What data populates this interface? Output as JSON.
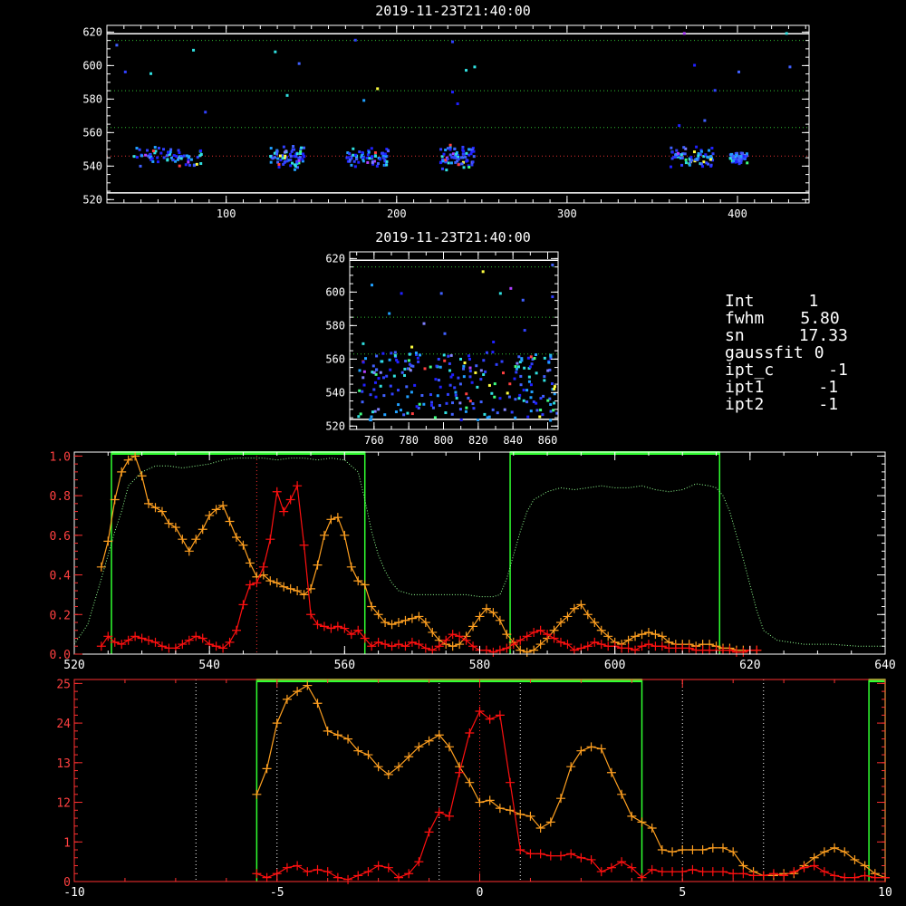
{
  "info": [
    {
      "label": "Int",
      "value": "1"
    },
    {
      "label": "fwhm",
      "value": "5.80"
    },
    {
      "label": "sn",
      "value": "17.33"
    },
    {
      "label": "gaussfit",
      "value": "0"
    },
    {
      "label": "ipt_c",
      "value": "-1"
    },
    {
      "label": "ipt1",
      "value": "-1"
    },
    {
      "label": "ipt2",
      "value": "-1"
    }
  ],
  "chart_data": [
    {
      "type": "scatter",
      "title": "2019-11-23T21:40:00",
      "xlim": [
        30,
        442
      ],
      "ylim": [
        518,
        624
      ],
      "xticks": [
        100,
        200,
        300,
        400
      ],
      "yticks": [
        520,
        540,
        560,
        580,
        600,
        620
      ],
      "hlines_white": [
        524,
        619
      ],
      "hlines_green": [
        563,
        585,
        615
      ],
      "hlines_red": [
        546
      ],
      "clusters": [
        [
          45,
          85,
          546,
          7
        ],
        [
          125,
          145,
          546,
          8
        ],
        [
          170,
          195,
          546,
          7
        ],
        [
          225,
          245,
          546,
          8
        ],
        [
          360,
          385,
          546,
          7
        ],
        [
          395,
          405,
          546,
          4
        ]
      ],
      "scatter_points": [
        [
          35,
          613
        ],
        [
          40,
          597
        ],
        [
          55,
          596
        ],
        [
          80,
          610
        ],
        [
          128,
          609
        ],
        [
          142,
          602
        ],
        [
          175,
          616
        ],
        [
          188,
          587
        ],
        [
          232,
          615
        ],
        [
          240,
          598
        ],
        [
          245,
          600
        ],
        [
          368,
          620
        ],
        [
          374,
          601
        ],
        [
          386,
          586
        ],
        [
          400,
          597
        ],
        [
          428,
          620
        ],
        [
          232,
          585
        ],
        [
          235,
          578
        ],
        [
          135,
          583
        ],
        [
          180,
          580
        ],
        [
          365,
          565
        ],
        [
          380,
          568
        ],
        [
          87,
          573
        ],
        [
          430,
          600
        ]
      ]
    },
    {
      "type": "scatter",
      "title": "2019-11-23T21:40:00",
      "xlim": [
        746,
        866
      ],
      "ylim": [
        518,
        624
      ],
      "xticks": [
        760,
        780,
        800,
        820,
        840,
        860
      ],
      "yticks": [
        520,
        540,
        560,
        580,
        600,
        620
      ],
      "hlines_white": [
        524,
        619
      ],
      "hlines_green": [
        563,
        585,
        615
      ],
      "density_region": [
        750,
        866,
        524,
        565
      ],
      "scatter_points": [
        [
          758,
          605
        ],
        [
          775,
          600
        ],
        [
          798,
          600
        ],
        [
          822,
          613
        ],
        [
          832,
          600
        ],
        [
          838,
          603
        ],
        [
          862,
          617
        ],
        [
          768,
          588
        ],
        [
          788,
          582
        ],
        [
          800,
          576
        ],
        [
          828,
          571
        ],
        [
          846,
          578
        ],
        [
          753,
          570
        ],
        [
          781,
          568
        ],
        [
          845,
          596
        ],
        [
          862,
          598
        ]
      ]
    },
    {
      "type": "line",
      "xlim": [
        520,
        640
      ],
      "x_ticks": [
        520,
        540,
        560,
        580,
        600,
        620,
        640
      ],
      "y_tick_labels": [
        "0.0",
        "0.2",
        "0.4",
        "0.6",
        "0.8",
        "1.0"
      ],
      "y_tick_values": [
        0.0,
        0.2,
        0.4,
        0.6,
        0.8,
        1.0
      ],
      "ylim": [
        0,
        1.02
      ],
      "green_boxes": [
        [
          525.5,
          563.0
        ],
        [
          584.5,
          615.5
        ]
      ],
      "red_vline": 547,
      "series": [
        {
          "color": "#ffa020",
          "x": [
            524,
            525,
            526,
            527,
            528,
            529,
            530,
            531,
            532,
            533,
            534,
            535,
            536,
            537,
            538,
            539,
            540,
            541,
            542,
            543,
            544,
            545,
            546,
            547,
            548,
            549,
            550,
            551,
            552,
            553,
            554,
            555,
            556,
            557,
            558,
            559,
            560,
            561,
            562,
            563,
            564,
            565,
            566,
            567,
            568,
            569,
            570,
            571,
            572,
            573,
            574,
            575,
            576,
            577,
            578,
            579,
            580,
            581,
            582,
            583,
            584,
            585,
            586,
            587,
            588,
            589,
            590,
            591,
            592,
            593,
            594,
            595,
            596,
            597,
            598,
            599,
            600,
            601,
            602,
            603,
            604,
            605,
            606,
            607,
            608,
            609,
            610,
            611,
            612,
            613,
            614,
            615,
            616,
            617,
            618,
            619,
            620,
            621
          ],
          "y": [
            0.44,
            0.57,
            0.78,
            0.92,
            0.98,
            1.0,
            0.9,
            0.76,
            0.74,
            0.72,
            0.66,
            0.64,
            0.58,
            0.52,
            0.58,
            0.63,
            0.7,
            0.73,
            0.75,
            0.67,
            0.59,
            0.55,
            0.46,
            0.39,
            0.4,
            0.37,
            0.36,
            0.34,
            0.33,
            0.32,
            0.3,
            0.33,
            0.45,
            0.6,
            0.68,
            0.69,
            0.6,
            0.44,
            0.37,
            0.35,
            0.24,
            0.2,
            0.16,
            0.15,
            0.16,
            0.17,
            0.18,
            0.19,
            0.16,
            0.11,
            0.07,
            0.05,
            0.04,
            0.05,
            0.09,
            0.14,
            0.19,
            0.23,
            0.21,
            0.17,
            0.1,
            0.06,
            0.02,
            0.01,
            0.02,
            0.05,
            0.08,
            0.12,
            0.16,
            0.19,
            0.23,
            0.25,
            0.2,
            0.16,
            0.12,
            0.09,
            0.06,
            0.05,
            0.07,
            0.09,
            0.1,
            0.11,
            0.1,
            0.09,
            0.06,
            0.05,
            0.05,
            0.05,
            0.04,
            0.05,
            0.05,
            0.04,
            0.03,
            0.03,
            0.02,
            0.02,
            0.02,
            0.02
          ]
        },
        {
          "color": "#ff1010",
          "x": [
            524,
            525,
            526,
            527,
            528,
            529,
            530,
            531,
            532,
            533,
            534,
            535,
            536,
            537,
            538,
            539,
            540,
            541,
            542,
            543,
            544,
            545,
            546,
            547,
            548,
            549,
            550,
            551,
            552,
            553,
            554,
            555,
            556,
            557,
            558,
            559,
            560,
            561,
            562,
            563,
            564,
            565,
            566,
            567,
            568,
            569,
            570,
            571,
            572,
            573,
            574,
            575,
            576,
            577,
            578,
            579,
            580,
            581,
            582,
            583,
            584,
            585,
            586,
            587,
            588,
            589,
            590,
            591,
            592,
            593,
            594,
            595,
            596,
            597,
            598,
            599,
            600,
            601,
            602,
            603,
            604,
            605,
            606,
            607,
            608,
            609,
            610,
            611,
            612,
            613,
            614,
            615,
            616,
            617,
            618,
            619,
            620,
            621
          ],
          "y": [
            0.04,
            0.09,
            0.06,
            0.05,
            0.07,
            0.09,
            0.08,
            0.07,
            0.06,
            0.04,
            0.03,
            0.03,
            0.05,
            0.07,
            0.09,
            0.08,
            0.05,
            0.04,
            0.03,
            0.06,
            0.12,
            0.25,
            0.35,
            0.36,
            0.44,
            0.58,
            0.82,
            0.72,
            0.78,
            0.85,
            0.55,
            0.2,
            0.15,
            0.14,
            0.13,
            0.14,
            0.13,
            0.1,
            0.12,
            0.08,
            0.04,
            0.06,
            0.05,
            0.04,
            0.05,
            0.04,
            0.06,
            0.05,
            0.03,
            0.02,
            0.04,
            0.07,
            0.1,
            0.09,
            0.07,
            0.04,
            0.02,
            0.02,
            0.01,
            0.02,
            0.03,
            0.05,
            0.07,
            0.09,
            0.11,
            0.12,
            0.1,
            0.08,
            0.06,
            0.05,
            0.02,
            0.03,
            0.04,
            0.06,
            0.05,
            0.04,
            0.04,
            0.03,
            0.03,
            0.02,
            0.04,
            0.05,
            0.04,
            0.04,
            0.03,
            0.03,
            0.03,
            0.03,
            0.02,
            0.02,
            0.02,
            0.02,
            0.02,
            0.02,
            0.01,
            0.01,
            0.02,
            0.02
          ]
        },
        {
          "color": "#90ff90",
          "style": "dotted",
          "x": [
            520,
            522,
            524,
            525,
            526,
            527,
            528,
            530,
            532,
            534,
            536,
            538,
            540,
            542,
            544,
            546,
            548,
            550,
            552,
            554,
            556,
            558,
            560,
            562,
            563,
            564,
            565,
            566,
            567,
            568,
            569,
            570,
            572,
            574,
            576,
            578,
            580,
            582,
            583,
            584,
            585,
            586,
            587,
            588,
            590,
            592,
            594,
            596,
            598,
            600,
            602,
            604,
            606,
            608,
            610,
            612,
            614,
            615,
            616,
            617,
            618,
            619,
            620,
            621,
            622,
            624,
            628,
            632,
            636,
            640
          ],
          "y": [
            0.05,
            0.15,
            0.38,
            0.5,
            0.62,
            0.72,
            0.85,
            0.92,
            0.95,
            0.95,
            0.94,
            0.95,
            0.96,
            0.98,
            0.99,
            0.99,
            0.99,
            0.98,
            0.99,
            0.99,
            0.98,
            0.99,
            0.98,
            0.92,
            0.78,
            0.62,
            0.5,
            0.42,
            0.36,
            0.32,
            0.31,
            0.3,
            0.3,
            0.3,
            0.3,
            0.3,
            0.29,
            0.29,
            0.3,
            0.38,
            0.5,
            0.62,
            0.72,
            0.78,
            0.82,
            0.84,
            0.83,
            0.84,
            0.85,
            0.84,
            0.84,
            0.85,
            0.83,
            0.82,
            0.83,
            0.86,
            0.85,
            0.84,
            0.8,
            0.72,
            0.6,
            0.48,
            0.35,
            0.22,
            0.12,
            0.07,
            0.05,
            0.05,
            0.04,
            0.04
          ]
        }
      ]
    },
    {
      "type": "line",
      "xlim": [
        -10,
        10
      ],
      "x_ticks": [
        -10,
        -5,
        0,
        5,
        10
      ],
      "y_tick_labels": [
        "0",
        "1",
        "12",
        "13",
        "24",
        "25"
      ],
      "y_tick_values": [
        0,
        0.2,
        0.4,
        0.6,
        0.8,
        1.0
      ],
      "ylim": [
        0,
        1.02
      ],
      "green_boxes": [
        [
          -5.5,
          4.0
        ],
        [
          9.6,
          10.0
        ]
      ],
      "red_vline": 0,
      "white_vlines": [
        -7,
        -5,
        -1,
        1,
        5,
        7
      ],
      "series": [
        {
          "color": "#ffa020",
          "x": [
            -5.5,
            -5.25,
            -5.0,
            -4.75,
            -4.5,
            -4.25,
            -4.0,
            -3.75,
            -3.5,
            -3.25,
            -3.0,
            -2.75,
            -2.5,
            -2.25,
            -2.0,
            -1.75,
            -1.5,
            -1.25,
            -1.0,
            -0.75,
            -0.5,
            -0.25,
            0.0,
            0.25,
            0.5,
            0.75,
            1.0,
            1.25,
            1.5,
            1.75,
            2.0,
            2.25,
            2.5,
            2.75,
            3.0,
            3.25,
            3.5,
            3.75,
            4.0,
            4.25,
            4.5,
            4.75,
            5.0,
            5.25,
            5.5,
            5.75,
            6.0,
            6.25,
            6.5,
            6.75,
            7.0,
            7.25,
            7.5,
            7.75,
            8.0,
            8.25,
            8.5,
            8.75,
            9.0,
            9.25,
            9.5,
            9.75,
            10.0
          ],
          "y": [
            0.44,
            0.57,
            0.8,
            0.92,
            0.96,
            0.99,
            0.9,
            0.76,
            0.74,
            0.72,
            0.66,
            0.64,
            0.58,
            0.54,
            0.58,
            0.63,
            0.68,
            0.71,
            0.74,
            0.68,
            0.58,
            0.5,
            0.4,
            0.41,
            0.37,
            0.36,
            0.34,
            0.33,
            0.27,
            0.3,
            0.42,
            0.58,
            0.66,
            0.68,
            0.67,
            0.55,
            0.44,
            0.33,
            0.3,
            0.27,
            0.16,
            0.15,
            0.16,
            0.16,
            0.16,
            0.17,
            0.17,
            0.15,
            0.08,
            0.05,
            0.03,
            0.03,
            0.04,
            0.04,
            0.08,
            0.12,
            0.15,
            0.17,
            0.15,
            0.11,
            0.08,
            0.04,
            0.02
          ]
        },
        {
          "color": "#ff1010",
          "x": [
            -5.5,
            -5.25,
            -5.0,
            -4.75,
            -4.5,
            -4.25,
            -4.0,
            -3.75,
            -3.5,
            -3.25,
            -3.0,
            -2.75,
            -2.5,
            -2.25,
            -2.0,
            -1.75,
            -1.5,
            -1.25,
            -1.0,
            -0.75,
            -0.5,
            -0.25,
            0.0,
            0.25,
            0.5,
            0.75,
            1.0,
            1.25,
            1.5,
            1.75,
            2.0,
            2.25,
            2.5,
            2.75,
            3.0,
            3.25,
            3.5,
            3.75,
            4.0,
            4.25,
            4.5,
            4.75,
            5.0,
            5.25,
            5.5,
            5.75,
            6.0,
            6.25,
            6.5,
            6.75,
            7.0,
            7.25,
            7.5,
            7.75,
            8.0,
            8.25,
            8.5,
            8.75,
            9.0,
            9.25,
            9.5,
            9.75,
            10.0
          ],
          "y": [
            0.04,
            0.02,
            0.04,
            0.07,
            0.08,
            0.05,
            0.06,
            0.05,
            0.02,
            0.01,
            0.03,
            0.05,
            0.08,
            0.07,
            0.02,
            0.04,
            0.1,
            0.25,
            0.35,
            0.33,
            0.55,
            0.75,
            0.86,
            0.82,
            0.84,
            0.5,
            0.16,
            0.14,
            0.14,
            0.13,
            0.13,
            0.14,
            0.12,
            0.11,
            0.05,
            0.07,
            0.1,
            0.07,
            0.02,
            0.06,
            0.05,
            0.05,
            0.05,
            0.06,
            0.05,
            0.05,
            0.05,
            0.04,
            0.04,
            0.03,
            0.03,
            0.04,
            0.03,
            0.05,
            0.07,
            0.08,
            0.05,
            0.03,
            0.02,
            0.02,
            0.03,
            0.02,
            0.02
          ]
        }
      ]
    }
  ]
}
